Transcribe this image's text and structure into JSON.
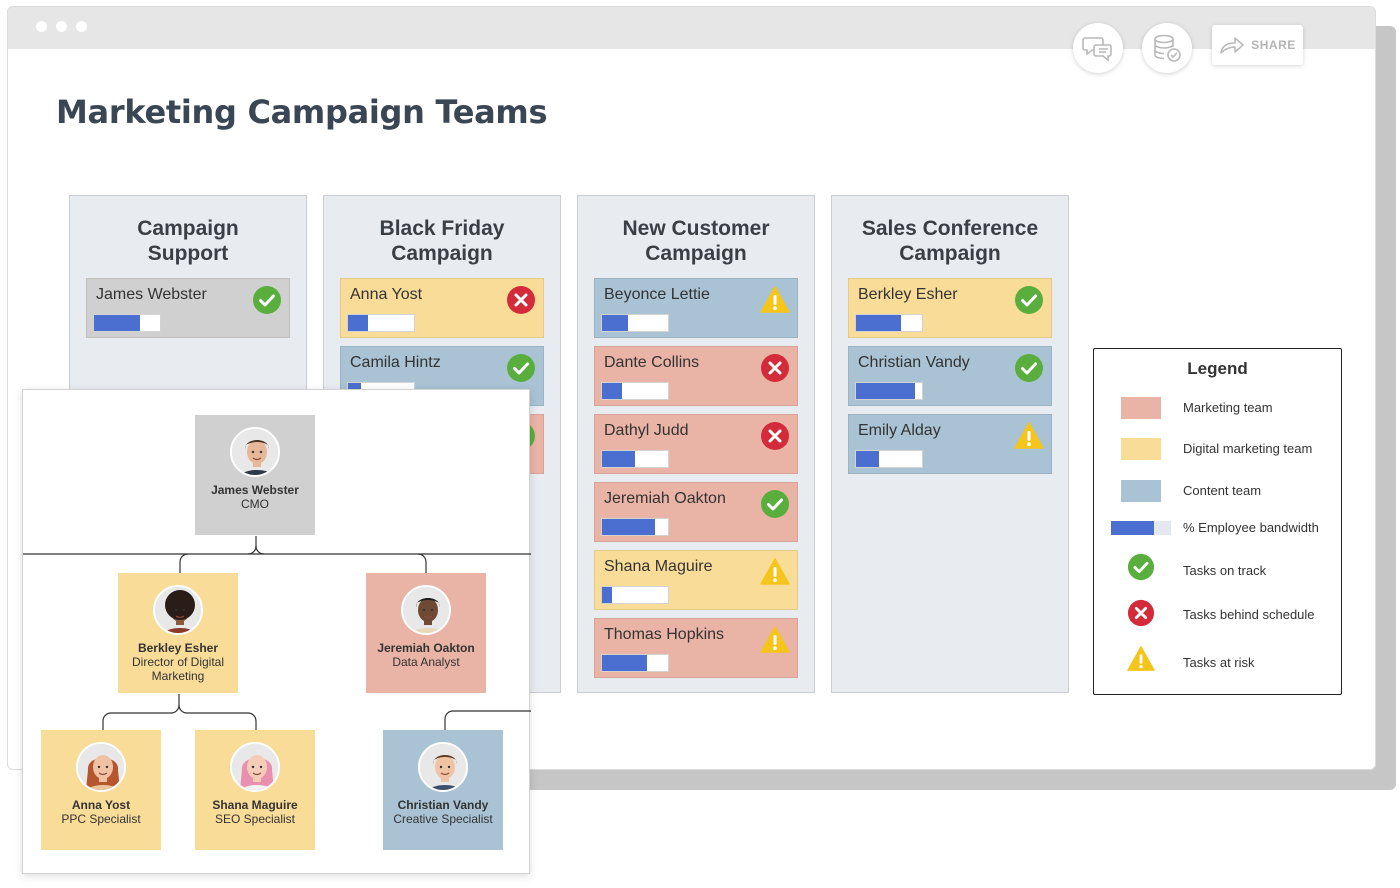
{
  "window": {
    "share_label": "SHARE",
    "title": "Marketing Campaign Teams"
  },
  "columns": [
    {
      "title_line1": "Campaign",
      "title_line2": "Support",
      "cards": [
        {
          "name": "James Webster",
          "team": "gray",
          "bandwidth": 0.7,
          "status": "on-track"
        }
      ]
    },
    {
      "title_line1": "Black Friday",
      "title_line2": "Campaign",
      "cards": [
        {
          "name": "Anna Yost",
          "team": "digital",
          "bandwidth": 0.3,
          "status": "behind"
        },
        {
          "name": "Camila Hintz",
          "team": "content",
          "bandwidth": 0.2,
          "status": "on-track"
        },
        {
          "name": "",
          "team": "marketing",
          "bandwidth": 0.0,
          "status": "on-track"
        }
      ]
    },
    {
      "title_line1": "New Customer",
      "title_line2": "Campaign",
      "cards": [
        {
          "name": "Beyonce Lettie",
          "team": "content",
          "bandwidth": 0.4,
          "status": "at-risk"
        },
        {
          "name": "Dante Collins",
          "team": "marketing",
          "bandwidth": 0.3,
          "status": "behind"
        },
        {
          "name": "Dathyl Judd",
          "team": "marketing",
          "bandwidth": 0.5,
          "status": "behind"
        },
        {
          "name": "Jeremiah Oakton",
          "team": "marketing",
          "bandwidth": 0.8,
          "status": "on-track"
        },
        {
          "name": "Shana Maguire",
          "team": "digital",
          "bandwidth": 0.15,
          "status": "at-risk"
        },
        {
          "name": "Thomas Hopkins",
          "team": "marketing",
          "bandwidth": 0.68,
          "status": "at-risk"
        }
      ]
    },
    {
      "title_line1": "Sales Conference",
      "title_line2": "Campaign",
      "cards": [
        {
          "name": "Berkley Esher",
          "team": "digital",
          "bandwidth": 0.68,
          "status": "on-track"
        },
        {
          "name": "Christian Vandy",
          "team": "content",
          "bandwidth": 0.9,
          "status": "on-track"
        },
        {
          "name": "Emily Alday",
          "team": "content",
          "bandwidth": 0.35,
          "status": "at-risk"
        }
      ]
    }
  ],
  "legend": {
    "title": "Legend",
    "items": [
      {
        "label": "Marketing team"
      },
      {
        "label": "Digital marketing team"
      },
      {
        "label": "Content team"
      },
      {
        "label": "% Employee bandwidth"
      },
      {
        "label": "Tasks on track"
      },
      {
        "label": "Tasks behind schedule"
      },
      {
        "label": "Tasks at risk"
      }
    ]
  },
  "org": {
    "nodes": [
      {
        "name": "James Webster",
        "role": "CMO",
        "team": "gray"
      },
      {
        "name": "Berkley Esher",
        "role": "Director of Digital Marketing",
        "team": "digital"
      },
      {
        "name": "Jeremiah Oakton",
        "role": "Data Analyst",
        "team": "marketing"
      },
      {
        "name": "Anna Yost",
        "role": "PPC Specialist",
        "team": "digital"
      },
      {
        "name": "Shana Maguire",
        "role": "SEO Specialist",
        "team": "digital"
      },
      {
        "name": "Christian Vandy",
        "role": "Creative Specialist",
        "team": "content"
      }
    ]
  },
  "colors": {
    "marketing": "#e9b3a5",
    "digital": "#f9dc98",
    "content": "#a9c3d4",
    "gray": "#d0d0d0",
    "bandwidth": "#4a6fd0",
    "on_track": "#5aae3e",
    "behind": "#d42b3a",
    "at_risk": "#f5c51c"
  }
}
